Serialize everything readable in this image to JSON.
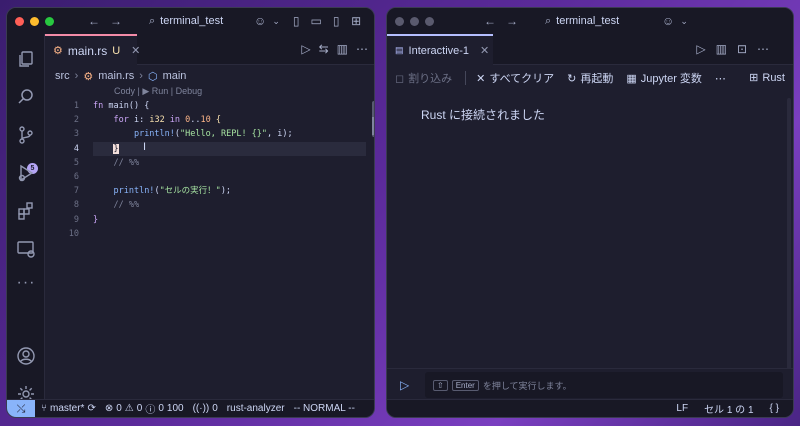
{
  "left_window": {
    "title": "terminal_test",
    "tab": {
      "filename": "main.rs",
      "status": "U"
    },
    "breadcrumb": {
      "folder": "src",
      "file": "main.rs",
      "symbol": "main"
    },
    "codelens": "Cody | ▶ Run | Debug",
    "line_numbers": [
      "1",
      "2",
      "3",
      "4",
      "5",
      "6",
      "7",
      "8",
      "9",
      "10"
    ],
    "current_line": "4",
    "code": {
      "l1_kw": "fn",
      "l1_rest": " main() {",
      "l2_kw_for": "for",
      "l2_var": " i: ",
      "l2_ty": "i32",
      "l2_in": " in ",
      "l2_range_a": "0",
      "l2_range_dots": "..",
      "l2_range_b": "10",
      "l2_brace": " {",
      "l3_mac": "println!",
      "l3_open": "(",
      "l3_str": "\"Hello, REPL! {}\"",
      "l3_rest": ", i);",
      "l4_brace": "}",
      "l5_comment": "// %%",
      "l7_mac": "println!",
      "l7_open": "(",
      "l7_str": "\"セルの実行！\"",
      "l7_rest": ");",
      "l8_comment": "// %%",
      "l9_brace": "}"
    },
    "activity_badge": "5",
    "status": {
      "branch": "master*",
      "errors": "0",
      "warnings": "0",
      "infos": "0",
      "count": "100",
      "ports": "0",
      "analyzer": "rust-analyzer",
      "mode": "-- NORMAL --"
    }
  },
  "right_window": {
    "title": "terminal_test",
    "tab": "Interactive-1",
    "toolbar": {
      "interrupt": "割り込み",
      "clear_all": "すべてクリア",
      "restart": "再起動",
      "variables": "Jupyter 変数",
      "more": "⋯",
      "kernel": "Rust"
    },
    "message": "Rust に接続されました",
    "input": {
      "shift_key": "⇧",
      "enter_key": "Enter",
      "hint": "を押して実行します。"
    },
    "status": {
      "eol": "LF",
      "position": "セル 1 の 1",
      "braces": "{ }"
    }
  },
  "colors": {
    "accent_pink": "#f38ba8",
    "accent_lavender": "#b4befe",
    "background": "#1e1e2e",
    "traffic_red": "#ff5f57",
    "traffic_yellow": "#febc2e",
    "traffic_green": "#28c840"
  }
}
